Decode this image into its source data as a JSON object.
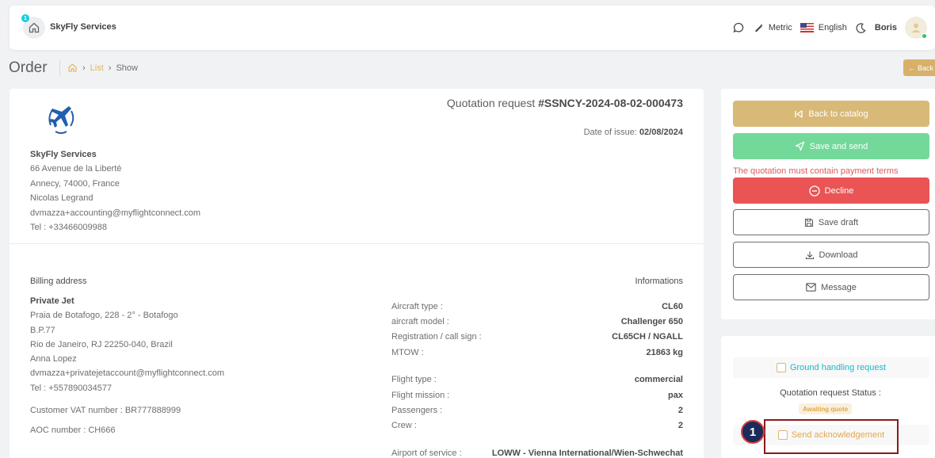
{
  "app": {
    "brand_name": "SkyFly Services",
    "brand_badge": "1"
  },
  "topbar": {
    "units_label": "Metric",
    "language_label": "English",
    "user_name": "Boris",
    "icons": [
      "chat-icon",
      "ruler-icon",
      "flag-us-icon",
      "moon-icon",
      "user-avatar-icon"
    ]
  },
  "breadcrumb": {
    "page_title": "Order",
    "items": [
      "List",
      "Show"
    ],
    "back_label": "Back"
  },
  "quotation": {
    "title_prefix": "Quotation request",
    "number": "#SSNCY-2024-08-02-000473",
    "issue_label": "Date of issue:",
    "issue_date": "02/08/2024"
  },
  "company": {
    "name": "SkyFly Services",
    "address1": "66 Avenue de la Liberté",
    "address2": "Annecy,  74000,  France",
    "contact": "Nicolas Legrand",
    "email": "dvmazza+accounting@myflightconnect.com",
    "phone": "Tel : +33466009988"
  },
  "billing": {
    "heading": "Billing address",
    "name": "Private Jet",
    "address1": "Praia de Botafogo, 228 - 2° - Botafogo",
    "address2": "B.P.77",
    "address3": "Rio de Janeiro,  RJ 22250-040,  Brazil",
    "contact": "Anna Lopez",
    "email": "dvmazza+privatejetaccount@myflightconnect.com",
    "phone": "Tel : +557890034577",
    "vat": "Customer VAT number : BR777888999",
    "aoc": "AOC number : CH666"
  },
  "informations": {
    "heading": "Informations",
    "group1": [
      {
        "label": "Aircraft type :",
        "value": "CL60"
      },
      {
        "label": "aircraft model :",
        "value": "Challenger 650"
      },
      {
        "label": "Registration / call sign :",
        "value": "CL65CH / NGALL"
      },
      {
        "label": "MTOW :",
        "value": "21863 kg"
      }
    ],
    "group2": [
      {
        "label": "Flight type :",
        "value": "commercial"
      },
      {
        "label": "Flight mission :",
        "value": "pax"
      },
      {
        "label": "Passengers :",
        "value": "2"
      },
      {
        "label": "Crew :",
        "value": "2"
      }
    ],
    "group3": [
      {
        "label": "Airport of service :",
        "value": "LOWW - Vienna International/Wien-Schwechat"
      }
    ]
  },
  "actions": {
    "back_catalog": "Back to catalog",
    "save_send": "Save and send",
    "warning": "The quotation must contain payment terms",
    "decline": "Decline",
    "save_draft": "Save draft",
    "download": "Download",
    "message": "Message"
  },
  "status": {
    "ground_handling": "Ground handling request",
    "status_label": "Quotation request Status :",
    "status_value": "Awaiting quote",
    "send_ack": "Send acknowledgement"
  },
  "annotation": {
    "marker": "1"
  },
  "colors": {
    "gold": "#d8b977",
    "green": "#73d99a",
    "red": "#ea5455",
    "cyan": "#19b8c9"
  }
}
